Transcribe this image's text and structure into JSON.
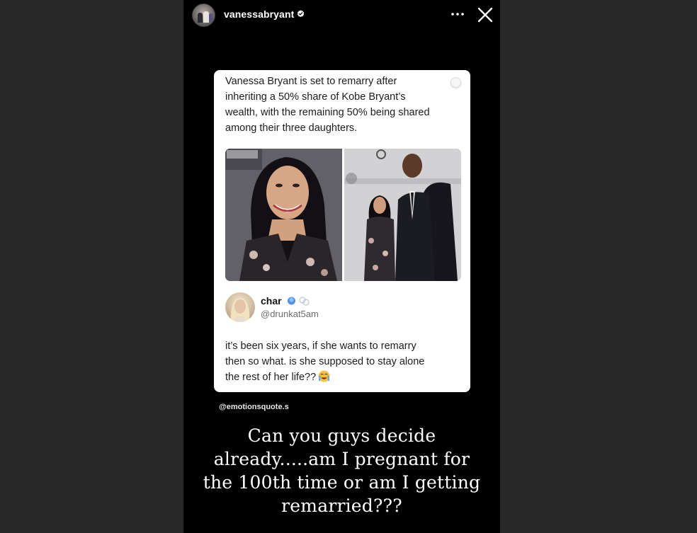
{
  "story": {
    "username": "vanessabryant",
    "icons": {
      "verified": "verified-badge-icon",
      "more": "more-options-icon",
      "close": "close-icon"
    },
    "source_tag": "@emotionsquote.s",
    "caption_lines": [
      "Can you guys decide",
      "already.....am I pregnant for",
      "the 100th time or am I getting",
      "remarried???"
    ]
  },
  "post": {
    "text_lines": [
      "Vanessa Bryant is set to remarry after",
      "inheriting a 50% share of Kobe Bryant’s",
      "wealth, with the remaining 50% being shared",
      "among their three daughters."
    ],
    "reply": {
      "name": "char",
      "handle": "@drunkat5am",
      "text_lines": [
        "it’s been six years, if she wants to remarry",
        "then so what. is she supposed to stay alone",
        "the rest of her life??"
      ],
      "emoji": "loudly-crying-face-icon"
    }
  },
  "colors": {
    "story_bg": "#000000",
    "backdrop": "#282828",
    "card_bg": "#ffffff",
    "verified_blue": "#3897f0"
  }
}
